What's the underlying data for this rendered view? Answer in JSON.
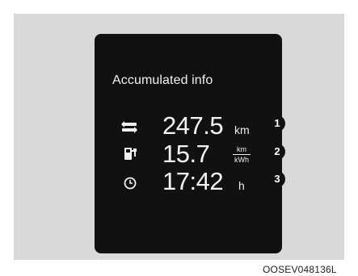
{
  "panel": {
    "title": "Accumulated info"
  },
  "rows": [
    {
      "icon": "distance-road-icon",
      "value": "247.5",
      "unit": "km",
      "callout": "1"
    },
    {
      "icon": "energy-charger-icon",
      "value": "15.7",
      "unit_numerator": "km",
      "unit_denominator": "kWh",
      "callout": "2"
    },
    {
      "icon": "clock-icon",
      "value": "17:42",
      "unit": "h",
      "callout": "3"
    }
  ],
  "reference_code": "OOSEV048136L",
  "colors": {
    "display_background": "#111111",
    "bezel": "#d9d9d9",
    "text": "#f4f4f4",
    "callout_background": "#111111"
  }
}
